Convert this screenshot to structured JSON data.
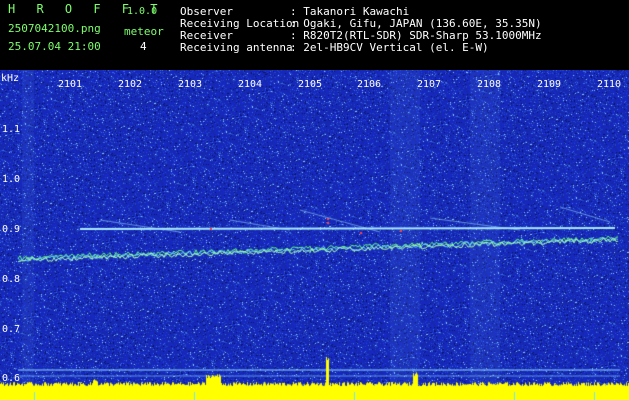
{
  "app": {
    "name": "H R O F F T",
    "version": "1.0.0"
  },
  "file": {
    "name": "2507042100.png",
    "datetime": "25.07.04 21:00"
  },
  "meteor": {
    "label": "meteor",
    "count": "4"
  },
  "info": [
    {
      "key": "Observer",
      "value": ": Takanori Kawachi"
    },
    {
      "key": "Receiving Location",
      "value": ": Ogaki, Gifu, JAPAN (136.60E, 35.35N)"
    },
    {
      "key": "Receiver",
      "value": ": R820T2(RTL-SDR) SDR-Sharp 53.1000MHz"
    },
    {
      "key": "Receiving antenna",
      "value": ": 2el-HB9CV Vertical (el. E-W)"
    }
  ],
  "axis": {
    "unit": "kHz",
    "y_ticks": [
      "1.1",
      "1.0",
      "0.9",
      "0.8",
      "0.7",
      "0.6"
    ],
    "x_ticks": [
      "2101",
      "2102",
      "2103",
      "2104",
      "2105",
      "2106",
      "2107",
      "2108",
      "2109",
      "2110"
    ]
  },
  "colors": {
    "background": "#1a2fa8",
    "trace": "#9fe8ff",
    "level": "#ffff00",
    "label": "#7cff6b"
  }
}
